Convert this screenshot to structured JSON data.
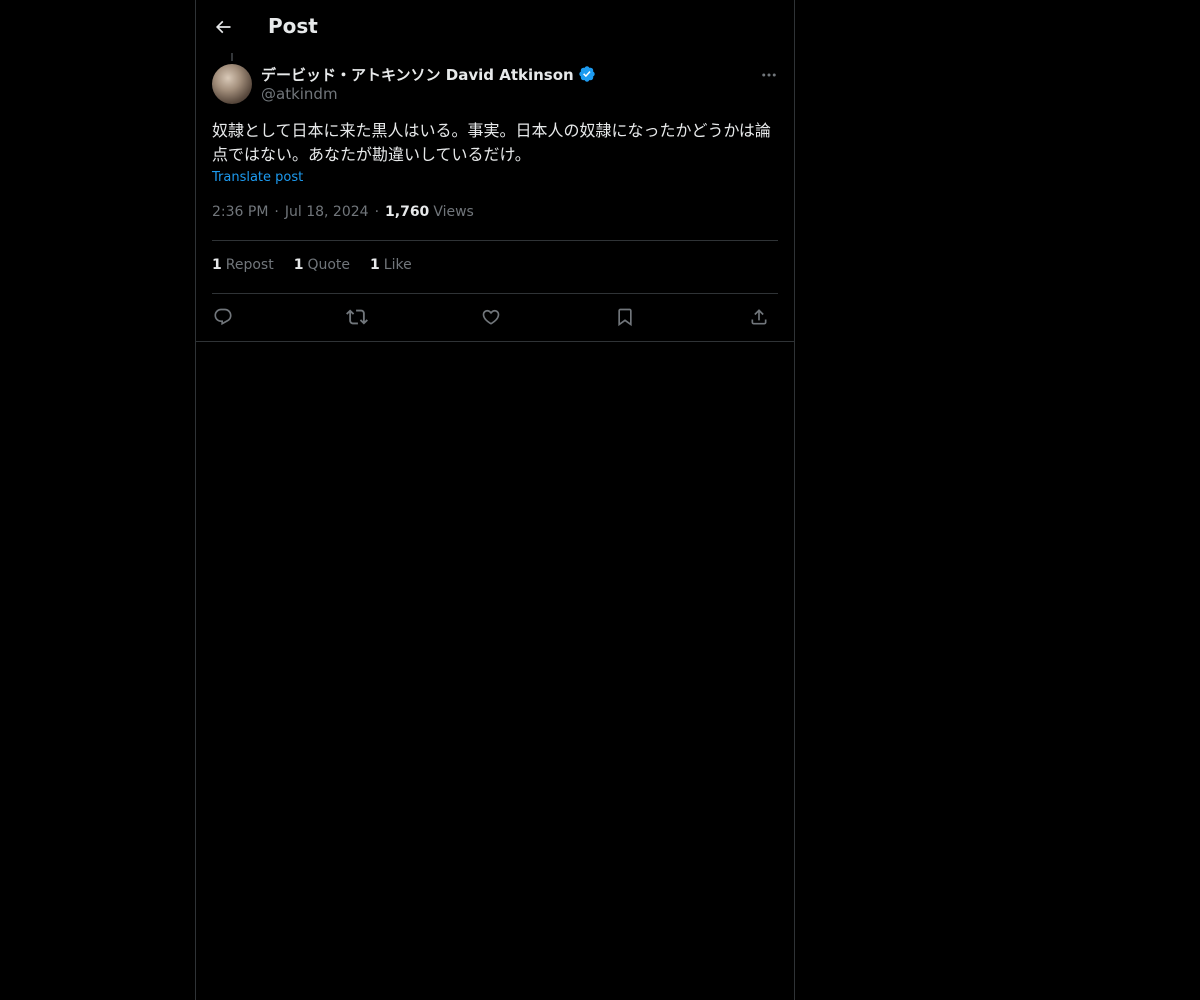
{
  "header": {
    "title": "Post",
    "back_icon": "arrow-left-icon"
  },
  "author": {
    "display_name": "デービッド・アトキンソン David Atkinson",
    "handle": "@atkindm",
    "verified": true,
    "verified_color": "#1d9bf0"
  },
  "post": {
    "text": "奴隷として日本に来た黒人はいる。事実。日本人の奴隷になったかどうかは論点ではない。あなたが勘違いしているだけ。",
    "translate_label": "Translate post",
    "time": "2:36 PM",
    "date": "Jul 18, 2024",
    "separator": "·",
    "views_count": "1,760",
    "views_label": "Views"
  },
  "stats": {
    "reposts": {
      "count": "1",
      "label": "Repost"
    },
    "quotes": {
      "count": "1",
      "label": "Quote"
    },
    "likes": {
      "count": "1",
      "label": "Like"
    }
  },
  "actions": [
    "reply-icon",
    "repost-icon",
    "like-icon",
    "bookmark-icon",
    "share-icon"
  ],
  "colors": {
    "background": "#000000",
    "text_primary": "#e7e9ea",
    "text_secondary": "#71767b",
    "border": "#2f3336",
    "accent": "#1d9bf0"
  }
}
